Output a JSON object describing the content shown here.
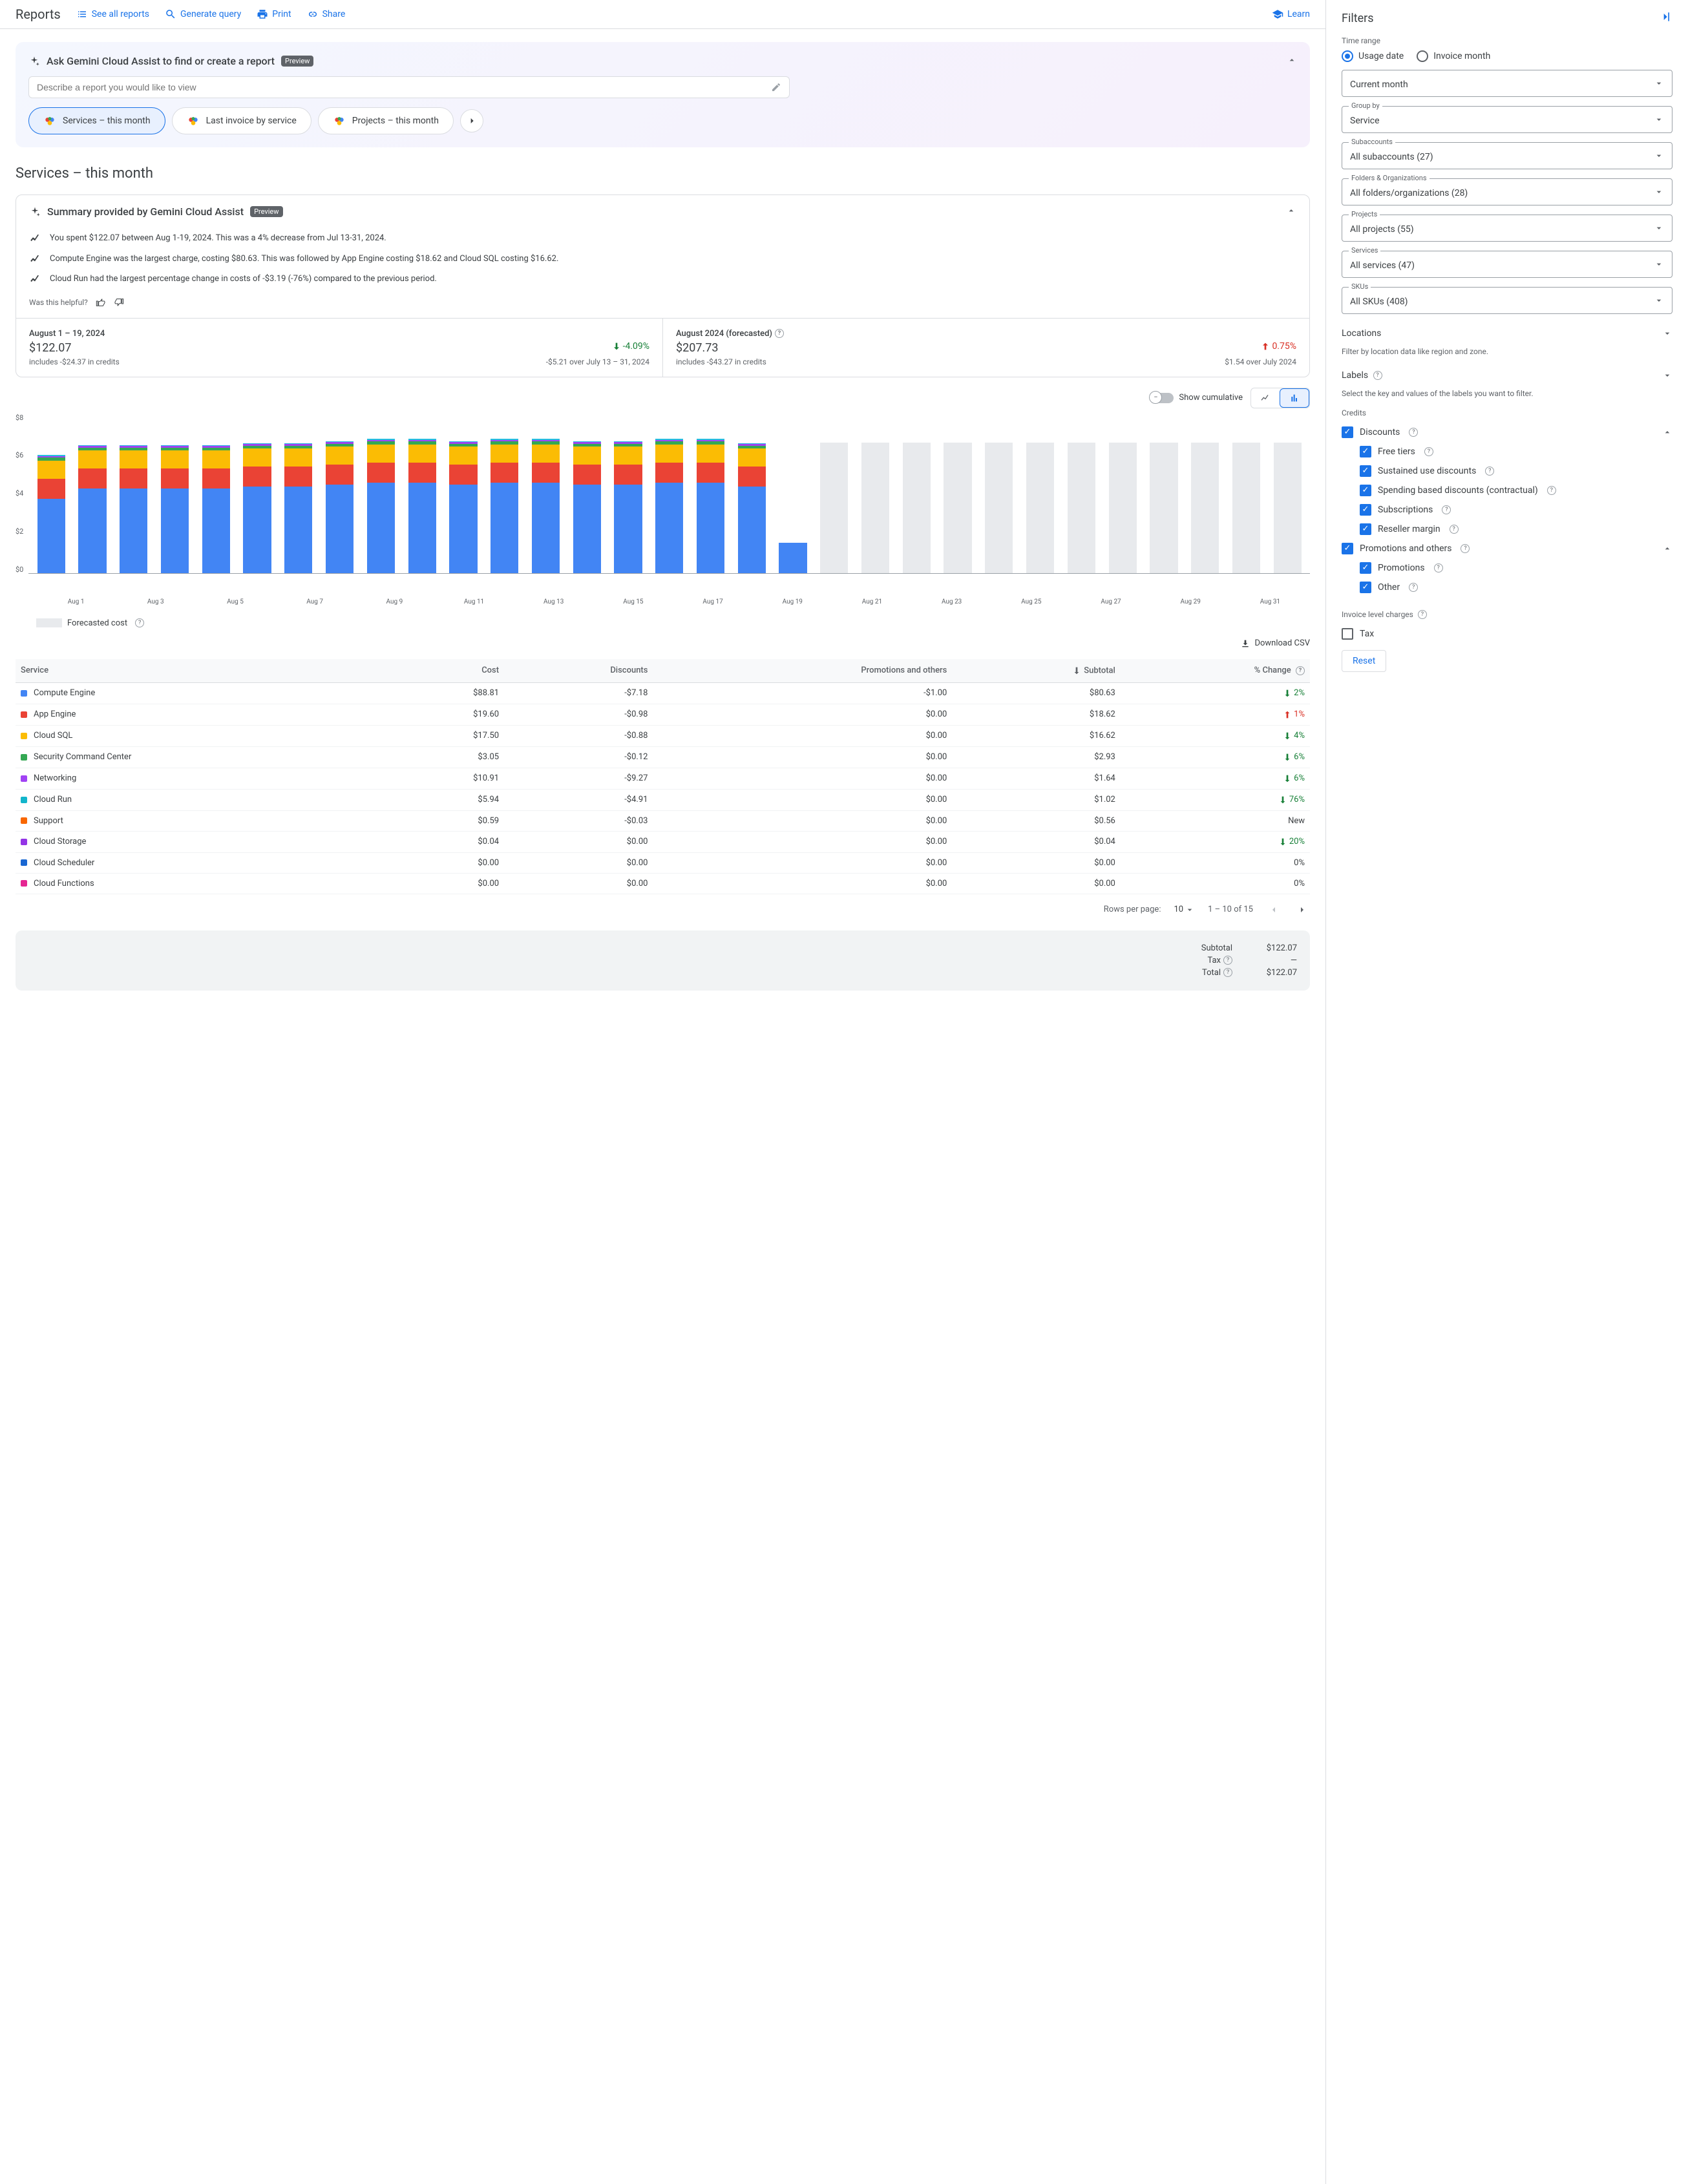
{
  "header": {
    "title": "Reports",
    "see_all": "See all reports",
    "generate_query": "Generate query",
    "print": "Print",
    "share": "Share",
    "learn": "Learn"
  },
  "gemini": {
    "title": "Ask Gemini Cloud Assist to find or create a report",
    "preview": "Preview",
    "placeholder": "Describe a report you would like to view",
    "chips": [
      "Services – this month",
      "Last invoice by service",
      "Projects – this month"
    ]
  },
  "report_title": "Services – this month",
  "summary": {
    "title": "Summary provided by Gemini Cloud Assist",
    "preview": "Preview",
    "insights": [
      "You spent $122.07 between Aug 1-19, 2024. This was a 4% decrease from Jul 13-31, 2024.",
      "Compute Engine was the largest charge, costing $80.63. This was followed by App Engine costing $18.62 and Cloud SQL costing $16.62.",
      "Cloud Run had the largest percentage change in costs of -$3.19 (-76%) compared to the previous period."
    ],
    "helpful": "Was this helpful?"
  },
  "kpis": {
    "left": {
      "period": "August 1 – 19, 2024",
      "value": "$122.07",
      "credits": "includes -$24.37 in credits",
      "change_pct": "-4.09%",
      "change_sub": "-$5.21 over July 13 – 31, 2024"
    },
    "right": {
      "period": "August 2024 (forecasted)",
      "value": "$207.73",
      "credits": "includes -$43.27 in credits",
      "change_pct": "0.75%",
      "change_sub": "$1.54 over July 2024"
    }
  },
  "chart_controls": {
    "cumulative": "Show cumulative",
    "forecast_label": "Forecasted cost",
    "download": "Download CSV"
  },
  "chart_data": {
    "type": "bar",
    "ylim": [
      0,
      8
    ],
    "yticks": [
      "$8",
      "$6",
      "$4",
      "$2",
      "$0"
    ],
    "xlabels": [
      "Aug 1",
      "Aug 3",
      "Aug 5",
      "Aug 7",
      "Aug 9",
      "Aug 11",
      "Aug 13",
      "Aug 15",
      "Aug 17",
      "Aug 19",
      "Aug 21",
      "Aug 23",
      "Aug 25",
      "Aug 27",
      "Aug 29",
      "Aug 31"
    ],
    "series_colors": {
      "Compute Engine": "#4285f4",
      "App Engine": "#ea4335",
      "Cloud SQL": "#fbbc04",
      "Security Command Center": "#34a853",
      "Networking": "#a142f4",
      "Cloud Run": "#24c1e0",
      "Other": "#9aa0a6",
      "Forecast": "#e8eaed"
    },
    "days": [
      {
        "d": "Aug 1",
        "stacks": [
          [
            "Compute Engine",
            3.7
          ],
          [
            "App Engine",
            1.0
          ],
          [
            "Cloud SQL",
            0.9
          ],
          [
            "Security Command Center",
            0.15
          ],
          [
            "Networking",
            0.08
          ],
          [
            "Cloud Run",
            0.05
          ]
        ],
        "forecast": false
      },
      {
        "d": "Aug 2",
        "stacks": [
          [
            "Compute Engine",
            4.2
          ],
          [
            "App Engine",
            1.0
          ],
          [
            "Cloud SQL",
            0.9
          ],
          [
            "Security Command Center",
            0.15
          ],
          [
            "Networking",
            0.08
          ],
          [
            "Cloud Run",
            0.05
          ]
        ],
        "forecast": false
      },
      {
        "d": "Aug 3",
        "stacks": [
          [
            "Compute Engine",
            4.2
          ],
          [
            "App Engine",
            1.0
          ],
          [
            "Cloud SQL",
            0.9
          ],
          [
            "Security Command Center",
            0.15
          ],
          [
            "Networking",
            0.08
          ],
          [
            "Cloud Run",
            0.05
          ]
        ],
        "forecast": false
      },
      {
        "d": "Aug 4",
        "stacks": [
          [
            "Compute Engine",
            4.2
          ],
          [
            "App Engine",
            1.0
          ],
          [
            "Cloud SQL",
            0.9
          ],
          [
            "Security Command Center",
            0.15
          ],
          [
            "Networking",
            0.08
          ],
          [
            "Cloud Run",
            0.05
          ]
        ],
        "forecast": false
      },
      {
        "d": "Aug 5",
        "stacks": [
          [
            "Compute Engine",
            4.2
          ],
          [
            "App Engine",
            1.0
          ],
          [
            "Cloud SQL",
            0.9
          ],
          [
            "Security Command Center",
            0.15
          ],
          [
            "Networking",
            0.08
          ],
          [
            "Cloud Run",
            0.05
          ]
        ],
        "forecast": false
      },
      {
        "d": "Aug 6",
        "stacks": [
          [
            "Compute Engine",
            4.3
          ],
          [
            "App Engine",
            1.0
          ],
          [
            "Cloud SQL",
            0.9
          ],
          [
            "Security Command Center",
            0.15
          ],
          [
            "Networking",
            0.08
          ],
          [
            "Cloud Run",
            0.05
          ]
        ],
        "forecast": false
      },
      {
        "d": "Aug 7",
        "stacks": [
          [
            "Compute Engine",
            4.3
          ],
          [
            "App Engine",
            1.0
          ],
          [
            "Cloud SQL",
            0.9
          ],
          [
            "Security Command Center",
            0.15
          ],
          [
            "Networking",
            0.08
          ],
          [
            "Cloud Run",
            0.05
          ]
        ],
        "forecast": false
      },
      {
        "d": "Aug 8",
        "stacks": [
          [
            "Compute Engine",
            4.4
          ],
          [
            "App Engine",
            1.0
          ],
          [
            "Cloud SQL",
            0.9
          ],
          [
            "Security Command Center",
            0.15
          ],
          [
            "Networking",
            0.08
          ],
          [
            "Cloud Run",
            0.05
          ]
        ],
        "forecast": false
      },
      {
        "d": "Aug 9",
        "stacks": [
          [
            "Compute Engine",
            4.5
          ],
          [
            "App Engine",
            1.0
          ],
          [
            "Cloud SQL",
            0.9
          ],
          [
            "Security Command Center",
            0.15
          ],
          [
            "Networking",
            0.08
          ],
          [
            "Cloud Run",
            0.05
          ]
        ],
        "forecast": false
      },
      {
        "d": "Aug 10",
        "stacks": [
          [
            "Compute Engine",
            4.5
          ],
          [
            "App Engine",
            1.0
          ],
          [
            "Cloud SQL",
            0.9
          ],
          [
            "Security Command Center",
            0.15
          ],
          [
            "Networking",
            0.08
          ],
          [
            "Cloud Run",
            0.05
          ]
        ],
        "forecast": false
      },
      {
        "d": "Aug 11",
        "stacks": [
          [
            "Compute Engine",
            4.4
          ],
          [
            "App Engine",
            1.0
          ],
          [
            "Cloud SQL",
            0.9
          ],
          [
            "Security Command Center",
            0.15
          ],
          [
            "Networking",
            0.08
          ],
          [
            "Cloud Run",
            0.05
          ]
        ],
        "forecast": false
      },
      {
        "d": "Aug 12",
        "stacks": [
          [
            "Compute Engine",
            4.5
          ],
          [
            "App Engine",
            1.0
          ],
          [
            "Cloud SQL",
            0.9
          ],
          [
            "Security Command Center",
            0.15
          ],
          [
            "Networking",
            0.08
          ],
          [
            "Cloud Run",
            0.05
          ]
        ],
        "forecast": false
      },
      {
        "d": "Aug 13",
        "stacks": [
          [
            "Compute Engine",
            4.5
          ],
          [
            "App Engine",
            1.0
          ],
          [
            "Cloud SQL",
            0.9
          ],
          [
            "Security Command Center",
            0.15
          ],
          [
            "Networking",
            0.08
          ],
          [
            "Cloud Run",
            0.05
          ]
        ],
        "forecast": false
      },
      {
        "d": "Aug 14",
        "stacks": [
          [
            "Compute Engine",
            4.4
          ],
          [
            "App Engine",
            1.0
          ],
          [
            "Cloud SQL",
            0.9
          ],
          [
            "Security Command Center",
            0.15
          ],
          [
            "Networking",
            0.08
          ],
          [
            "Cloud Run",
            0.05
          ]
        ],
        "forecast": false
      },
      {
        "d": "Aug 15",
        "stacks": [
          [
            "Compute Engine",
            4.4
          ],
          [
            "App Engine",
            1.0
          ],
          [
            "Cloud SQL",
            0.9
          ],
          [
            "Security Command Center",
            0.15
          ],
          [
            "Networking",
            0.08
          ],
          [
            "Cloud Run",
            0.05
          ]
        ],
        "forecast": false
      },
      {
        "d": "Aug 16",
        "stacks": [
          [
            "Compute Engine",
            4.5
          ],
          [
            "App Engine",
            1.0
          ],
          [
            "Cloud SQL",
            0.9
          ],
          [
            "Security Command Center",
            0.15
          ],
          [
            "Networking",
            0.08
          ],
          [
            "Cloud Run",
            0.05
          ]
        ],
        "forecast": false
      },
      {
        "d": "Aug 17",
        "stacks": [
          [
            "Compute Engine",
            4.5
          ],
          [
            "App Engine",
            1.0
          ],
          [
            "Cloud SQL",
            0.9
          ],
          [
            "Security Command Center",
            0.15
          ],
          [
            "Networking",
            0.08
          ],
          [
            "Cloud Run",
            0.05
          ]
        ],
        "forecast": false
      },
      {
        "d": "Aug 18",
        "stacks": [
          [
            "Compute Engine",
            4.3
          ],
          [
            "App Engine",
            1.0
          ],
          [
            "Cloud SQL",
            0.9
          ],
          [
            "Security Command Center",
            0.15
          ],
          [
            "Networking",
            0.08
          ],
          [
            "Cloud Run",
            0.05
          ]
        ],
        "forecast": false
      },
      {
        "d": "Aug 19",
        "stacks": [
          [
            "Compute Engine",
            1.5
          ]
        ],
        "forecast": false
      },
      {
        "d": "Aug 20",
        "stacks": [
          [
            "Forecast",
            6.5
          ]
        ],
        "forecast": true
      },
      {
        "d": "Aug 21",
        "stacks": [
          [
            "Forecast",
            6.5
          ]
        ],
        "forecast": true
      },
      {
        "d": "Aug 22",
        "stacks": [
          [
            "Forecast",
            6.5
          ]
        ],
        "forecast": true
      },
      {
        "d": "Aug 23",
        "stacks": [
          [
            "Forecast",
            6.5
          ]
        ],
        "forecast": true
      },
      {
        "d": "Aug 24",
        "stacks": [
          [
            "Forecast",
            6.5
          ]
        ],
        "forecast": true
      },
      {
        "d": "Aug 25",
        "stacks": [
          [
            "Forecast",
            6.5
          ]
        ],
        "forecast": true
      },
      {
        "d": "Aug 26",
        "stacks": [
          [
            "Forecast",
            6.5
          ]
        ],
        "forecast": true
      },
      {
        "d": "Aug 27",
        "stacks": [
          [
            "Forecast",
            6.5
          ]
        ],
        "forecast": true
      },
      {
        "d": "Aug 28",
        "stacks": [
          [
            "Forecast",
            6.5
          ]
        ],
        "forecast": true
      },
      {
        "d": "Aug 29",
        "stacks": [
          [
            "Forecast",
            6.5
          ]
        ],
        "forecast": true
      },
      {
        "d": "Aug 30",
        "stacks": [
          [
            "Forecast",
            6.5
          ]
        ],
        "forecast": true
      },
      {
        "d": "Aug 31",
        "stacks": [
          [
            "Forecast",
            6.5
          ]
        ],
        "forecast": true
      }
    ]
  },
  "table": {
    "headers": [
      "Service",
      "Cost",
      "Discounts",
      "Promotions and others",
      "Subtotal",
      "% Change"
    ],
    "rows": [
      {
        "color": "#4285f4",
        "shape": "circle",
        "service": "Compute Engine",
        "cost": "$88.81",
        "discounts": "-$7.18",
        "promo": "-$1.00",
        "subtotal": "$80.63",
        "change": "2%",
        "dir": "down"
      },
      {
        "color": "#ea4335",
        "shape": "square",
        "service": "App Engine",
        "cost": "$19.60",
        "discounts": "-$0.98",
        "promo": "$0.00",
        "subtotal": "$18.62",
        "change": "1%",
        "dir": "up"
      },
      {
        "color": "#fbbc04",
        "shape": "diamond",
        "service": "Cloud SQL",
        "cost": "$17.50",
        "discounts": "-$0.88",
        "promo": "$0.00",
        "subtotal": "$16.62",
        "change": "4%",
        "dir": "down"
      },
      {
        "color": "#34a853",
        "shape": "triangle-down",
        "service": "Security Command Center",
        "cost": "$3.05",
        "discounts": "-$0.12",
        "promo": "$0.00",
        "subtotal": "$2.93",
        "change": "6%",
        "dir": "down"
      },
      {
        "color": "#a142f4",
        "shape": "triangle-up",
        "service": "Networking",
        "cost": "$10.91",
        "discounts": "-$9.27",
        "promo": "$0.00",
        "subtotal": "$1.64",
        "change": "6%",
        "dir": "down"
      },
      {
        "color": "#12b5cb",
        "shape": "pentagon",
        "service": "Cloud Run",
        "cost": "$5.94",
        "discounts": "-$4.91",
        "promo": "$0.00",
        "subtotal": "$1.02",
        "change": "76%",
        "dir": "down"
      },
      {
        "color": "#f96700",
        "shape": "plus",
        "service": "Support",
        "cost": "$0.59",
        "discounts": "-$0.03",
        "promo": "$0.00",
        "subtotal": "$0.56",
        "change": "New",
        "dir": "none"
      },
      {
        "color": "#9334e6",
        "shape": "burst",
        "service": "Cloud Storage",
        "cost": "$0.04",
        "discounts": "$0.00",
        "promo": "$0.00",
        "subtotal": "$0.04",
        "change": "20%",
        "dir": "down"
      },
      {
        "color": "#1967d2",
        "shape": "shield",
        "service": "Cloud Scheduler",
        "cost": "$0.00",
        "discounts": "$0.00",
        "promo": "$0.00",
        "subtotal": "$0.00",
        "change": "0%",
        "dir": "none"
      },
      {
        "color": "#e52592",
        "shape": "star",
        "service": "Cloud Functions",
        "cost": "$0.00",
        "discounts": "$0.00",
        "promo": "$0.00",
        "subtotal": "$0.00",
        "change": "0%",
        "dir": "none"
      }
    ],
    "paginator": {
      "rows_label": "Rows per page:",
      "rows_value": "10",
      "range": "1 – 10 of 15"
    }
  },
  "totals": {
    "subtotal_label": "Subtotal",
    "subtotal_value": "$122.07",
    "tax_label": "Tax",
    "tax_value": "—",
    "total_label": "Total",
    "total_value": "$122.07"
  },
  "filters": {
    "title": "Filters",
    "time_range_label": "Time range",
    "radio_usage": "Usage date",
    "radio_invoice": "Invoice month",
    "current_month": "Current month",
    "group_by_label": "Group by",
    "group_by_value": "Service",
    "subaccounts_label": "Subaccounts",
    "subaccounts_value": "All subaccounts (27)",
    "folders_label": "Folders & Organizations",
    "folders_value": "All folders/organizations (28)",
    "projects_label": "Projects",
    "projects_value": "All projects (55)",
    "services_label": "Services",
    "services_value": "All services (47)",
    "skus_label": "SKUs",
    "skus_value": "All SKUs (408)",
    "locations_label": "Locations",
    "locations_desc": "Filter by location data like region and zone.",
    "labels_label": "Labels",
    "labels_desc": "Select the key and values of the labels you want to filter.",
    "credits_label": "Credits",
    "discounts_label": "Discounts",
    "free_tiers_label": "Free tiers",
    "sustained_label": "Sustained use discounts",
    "spending_label": "Spending based discounts (contractual)",
    "subscriptions_label": "Subscriptions",
    "reseller_label": "Reseller margin",
    "promotions_others_label": "Promotions and others",
    "promotions_label": "Promotions",
    "other_label": "Other",
    "invoice_charges_label": "Invoice level charges",
    "tax_checkbox": "Tax",
    "reset": "Reset"
  }
}
